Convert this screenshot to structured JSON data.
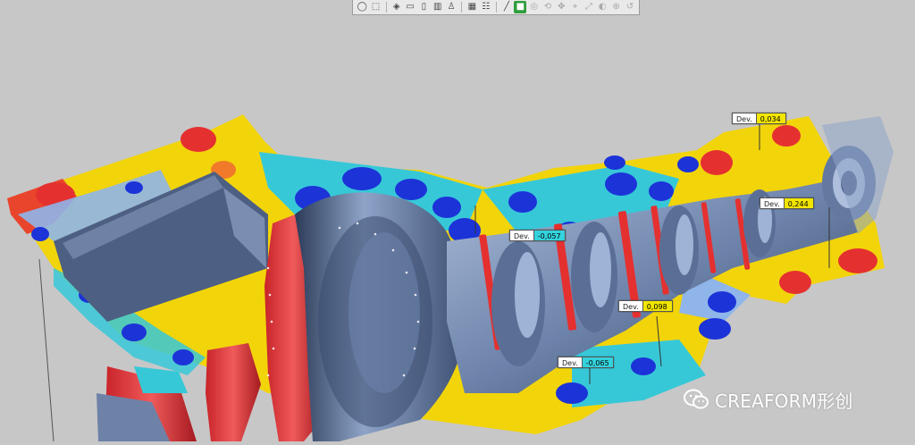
{
  "toolbar": {
    "buttons": [
      {
        "icon": "view-circle-icon",
        "glyph": "◯"
      },
      {
        "icon": "cube-view-icon",
        "glyph": "⬚"
      },
      {
        "icon": "iso-view-icon",
        "glyph": "◈"
      },
      {
        "icon": "front-view-icon",
        "glyph": "▭"
      },
      {
        "icon": "side-view-icon",
        "glyph": "▯"
      },
      {
        "icon": "top-view-icon",
        "glyph": "▥"
      },
      {
        "icon": "person-view-icon",
        "glyph": "♙"
      },
      {
        "icon": "grid-view-icon",
        "glyph": "▦"
      },
      {
        "icon": "table-view-icon",
        "glyph": "☷"
      },
      {
        "icon": "line-tool-icon",
        "glyph": "╱"
      },
      {
        "icon": "color-map-icon",
        "glyph": "■",
        "active": true
      },
      {
        "icon": "zoom-icon",
        "glyph": "◎",
        "disabled": true
      },
      {
        "icon": "rotate-icon",
        "glyph": "⟲",
        "disabled": true
      },
      {
        "icon": "pan-icon",
        "glyph": "✥",
        "disabled": true
      },
      {
        "icon": "measure-icon",
        "glyph": "⌖",
        "disabled": true
      },
      {
        "icon": "probe-icon",
        "glyph": "⤢",
        "disabled": true
      },
      {
        "icon": "section-icon",
        "glyph": "◐",
        "disabled": true
      },
      {
        "icon": "fit-icon",
        "glyph": "⊕",
        "disabled": true
      },
      {
        "icon": "reset-icon",
        "glyph": "↺",
        "disabled": true
      }
    ]
  },
  "annotations": [
    {
      "key": "Dev.",
      "value": "0,034",
      "color": "#f2e600"
    },
    {
      "key": "Dev.",
      "value": "0,244",
      "color": "#f2e600"
    },
    {
      "key": "Dev.",
      "value": "-0,057",
      "color": "#34d2dc"
    },
    {
      "key": "Dev.",
      "value": "0,098",
      "color": "#f2e600"
    },
    {
      "key": "Dev.",
      "value": "-0,065",
      "color": "#34d2dc"
    }
  ],
  "watermark": {
    "text": "CREAFORM形创",
    "icon": "wechat-icon"
  },
  "colors": {
    "background": "#c7c7c7",
    "red": "#e8383a",
    "yellow": "#f5d400",
    "cyan": "#37c8d8",
    "blue": "#1c33d8",
    "light_blue": "#8fb5ea",
    "steel": "#7f95b8"
  }
}
